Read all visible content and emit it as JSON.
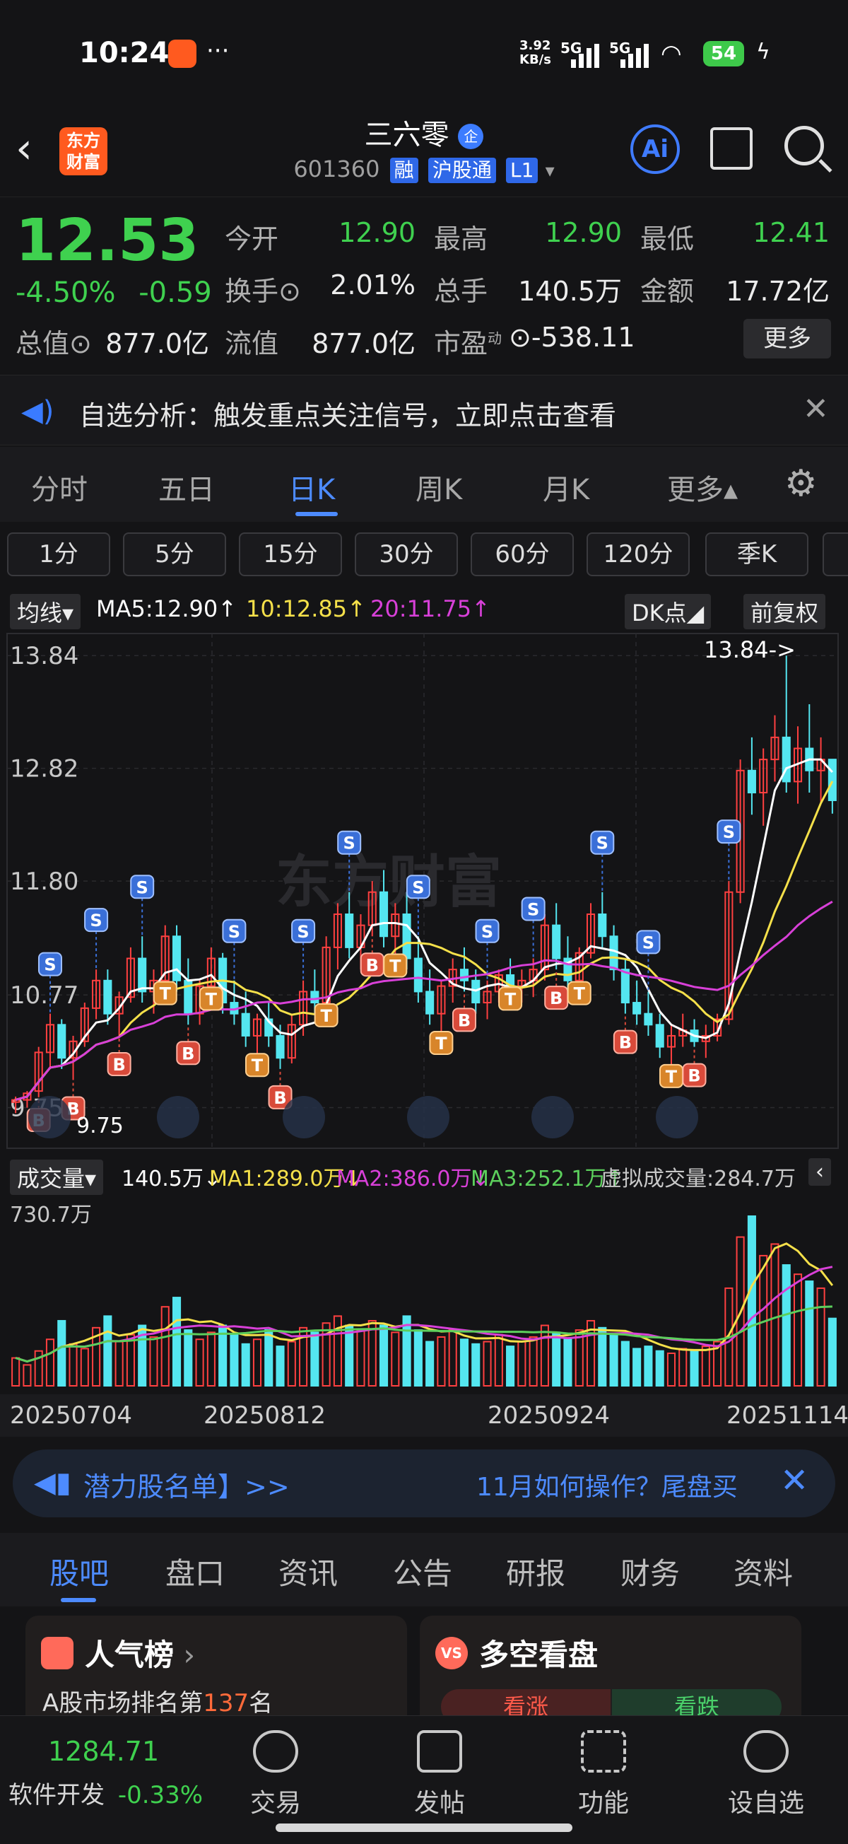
{
  "status_bar": {
    "time": "10:24",
    "net_speed_value": "3.92",
    "net_speed_unit": "KB/s",
    "sig1": "5G",
    "sig2": "5G",
    "battery": "54"
  },
  "header": {
    "logo_line1": "东方",
    "logo_line2": "财富",
    "stock_name": "三六零",
    "badge": "企",
    "stock_code": "601360",
    "tags": [
      "融",
      "沪股通",
      "L1"
    ],
    "ai_label": "Ai"
  },
  "quote": {
    "price": "12.53",
    "change_pct": "-4.50%",
    "change_amt": "-0.59",
    "rows": [
      [
        {
          "label": "今开",
          "value": "12.90",
          "green": true
        },
        {
          "label": "最高",
          "value": "12.90",
          "green": true
        },
        {
          "label": "最低",
          "value": "12.41",
          "green": true
        }
      ],
      [
        {
          "label": "换手⊙",
          "value": "2.01%",
          "green": false
        },
        {
          "label": "总手",
          "value": "140.5万",
          "green": false
        },
        {
          "label": "金额",
          "value": "17.72亿",
          "green": false
        }
      ]
    ],
    "total_value_label": "总值⊙",
    "total_value": "877.0亿",
    "float_label": "流值",
    "float_value": "877.0亿",
    "pe_label": "市盈",
    "pe_sup": "动",
    "pe_value": "⊙-538.11",
    "more": "更多"
  },
  "notice": {
    "text": "自选分析：触发重点关注信号，立即点击查看"
  },
  "tabs": [
    {
      "label": "分时",
      "active": false
    },
    {
      "label": "五日",
      "active": false
    },
    {
      "label": "日K",
      "active": true
    },
    {
      "label": "周K",
      "active": false
    },
    {
      "label": "月K",
      "active": false
    },
    {
      "label": "更多▴",
      "active": false
    }
  ],
  "periods": [
    "1分",
    "5分",
    "15分",
    "30分",
    "60分",
    "120分",
    "季K"
  ],
  "ma_row": {
    "selector": "均线▾",
    "ma5": "MA5:12.90↑",
    "ma10": "10:12.85↑",
    "ma20": "20:11.75↑",
    "dk": "DK点◢",
    "adjust": "前复权"
  },
  "colors": {
    "up": "#ff4040",
    "down": "#54e6f0",
    "ma5": "#ffffff",
    "ma10": "#f5e04a",
    "ma20": "#d840d8",
    "ma3": "#5ccf5c",
    "accent": "#4d8bff"
  },
  "chart_data": {
    "type": "candlestick",
    "y_ticks": [
      "13.84",
      "12.82",
      "11.80",
      "10.77",
      "9.75"
    ],
    "ylim": [
      9.6,
      13.95
    ],
    "high_label": "13.84->",
    "low_label": "9.75",
    "watermark": "东方财富",
    "candles": [
      [
        9.8,
        9.85,
        9.7,
        9.82
      ],
      [
        9.82,
        9.9,
        9.75,
        9.88
      ],
      [
        9.9,
        10.3,
        9.85,
        10.25
      ],
      [
        10.25,
        10.6,
        10.1,
        10.5
      ],
      [
        10.5,
        10.55,
        10.1,
        10.2
      ],
      [
        10.2,
        10.4,
        10.0,
        10.35
      ],
      [
        10.35,
        10.7,
        10.3,
        10.65
      ],
      [
        10.65,
        11.0,
        10.55,
        10.9
      ],
      [
        10.9,
        11.0,
        10.5,
        10.6
      ],
      [
        10.6,
        10.8,
        10.4,
        10.75
      ],
      [
        10.75,
        11.2,
        10.7,
        11.1
      ],
      [
        11.1,
        11.3,
        10.7,
        10.8
      ],
      [
        10.8,
        11.0,
        10.6,
        10.9
      ],
      [
        10.9,
        11.4,
        10.85,
        11.3
      ],
      [
        11.3,
        11.4,
        10.8,
        10.9
      ],
      [
        10.9,
        11.1,
        10.5,
        10.6
      ],
      [
        10.6,
        10.9,
        10.5,
        10.85
      ],
      [
        10.85,
        11.2,
        10.8,
        11.1
      ],
      [
        11.1,
        11.15,
        10.6,
        10.7
      ],
      [
        10.7,
        10.9,
        10.5,
        10.6
      ],
      [
        10.6,
        10.8,
        10.3,
        10.4
      ],
      [
        10.4,
        10.6,
        10.2,
        10.55
      ],
      [
        10.55,
        10.7,
        10.3,
        10.4
      ],
      [
        10.4,
        10.5,
        10.1,
        10.2
      ],
      [
        10.2,
        10.6,
        10.15,
        10.5
      ],
      [
        10.5,
        10.9,
        10.4,
        10.8
      ],
      [
        10.8,
        11.0,
        10.6,
        10.7
      ],
      [
        10.7,
        11.3,
        10.65,
        11.2
      ],
      [
        11.2,
        11.6,
        11.0,
        11.5
      ],
      [
        11.5,
        11.7,
        11.1,
        11.2
      ],
      [
        11.2,
        11.5,
        11.0,
        11.4
      ],
      [
        11.4,
        11.8,
        11.3,
        11.7
      ],
      [
        11.7,
        11.9,
        11.2,
        11.3
      ],
      [
        11.3,
        11.6,
        11.1,
        11.5
      ],
      [
        11.5,
        11.7,
        11.0,
        11.1
      ],
      [
        11.1,
        11.3,
        10.7,
        10.8
      ],
      [
        10.8,
        11.0,
        10.5,
        10.6
      ],
      [
        10.6,
        10.9,
        10.4,
        10.85
      ],
      [
        10.85,
        11.1,
        10.7,
        11.0
      ],
      [
        11.0,
        11.2,
        10.8,
        10.9
      ],
      [
        10.9,
        11.0,
        10.6,
        10.7
      ],
      [
        10.7,
        10.9,
        10.55,
        10.8
      ],
      [
        10.8,
        11.0,
        10.7,
        10.95
      ],
      [
        10.95,
        11.1,
        10.8,
        10.85
      ],
      [
        10.85,
        11.0,
        10.7,
        10.9
      ],
      [
        10.9,
        11.1,
        10.75,
        11.0
      ],
      [
        11.0,
        11.5,
        10.9,
        11.4
      ],
      [
        11.4,
        11.6,
        11.0,
        11.1
      ],
      [
        11.1,
        11.3,
        10.8,
        10.9
      ],
      [
        10.9,
        11.2,
        10.85,
        11.15
      ],
      [
        11.15,
        11.6,
        11.1,
        11.5
      ],
      [
        11.5,
        11.7,
        11.2,
        11.3
      ],
      [
        11.3,
        11.4,
        10.9,
        11.0
      ],
      [
        11.0,
        11.1,
        10.6,
        10.7
      ],
      [
        10.7,
        10.9,
        10.5,
        10.6
      ],
      [
        10.6,
        10.8,
        10.4,
        10.5
      ],
      [
        10.5,
        10.6,
        10.2,
        10.3
      ],
      [
        10.3,
        10.5,
        10.1,
        10.4
      ],
      [
        10.4,
        10.6,
        10.3,
        10.45
      ],
      [
        10.45,
        10.55,
        10.3,
        10.35
      ],
      [
        10.35,
        10.5,
        10.2,
        10.4
      ],
      [
        10.4,
        10.6,
        10.35,
        10.55
      ],
      [
        10.55,
        11.8,
        10.5,
        11.7
      ],
      [
        11.7,
        12.9,
        11.6,
        12.8
      ],
      [
        12.8,
        13.1,
        12.4,
        12.6
      ],
      [
        12.6,
        13.0,
        12.3,
        12.9
      ],
      [
        12.9,
        13.3,
        12.7,
        13.1
      ],
      [
        13.1,
        13.84,
        12.6,
        12.7
      ],
      [
        12.7,
        13.2,
        12.5,
        13.0
      ],
      [
        13.0,
        13.4,
        12.6,
        12.8
      ],
      [
        12.8,
        13.1,
        12.5,
        12.9
      ],
      [
        12.9,
        12.9,
        12.41,
        12.53
      ]
    ],
    "signals": [
      {
        "i": 2,
        "t": "B"
      },
      {
        "i": 3,
        "t": "S"
      },
      {
        "i": 5,
        "t": "B"
      },
      {
        "i": 7,
        "t": "S"
      },
      {
        "i": 9,
        "t": "B"
      },
      {
        "i": 11,
        "t": "S"
      },
      {
        "i": 13,
        "t": "T"
      },
      {
        "i": 15,
        "t": "B"
      },
      {
        "i": 17,
        "t": "T"
      },
      {
        "i": 19,
        "t": "S"
      },
      {
        "i": 21,
        "t": "T"
      },
      {
        "i": 23,
        "t": "B"
      },
      {
        "i": 25,
        "t": "S"
      },
      {
        "i": 27,
        "t": "T"
      },
      {
        "i": 29,
        "t": "S"
      },
      {
        "i": 31,
        "t": "B"
      },
      {
        "i": 33,
        "t": "T"
      },
      {
        "i": 35,
        "t": "S"
      },
      {
        "i": 37,
        "t": "T"
      },
      {
        "i": 39,
        "t": "B"
      },
      {
        "i": 41,
        "t": "S"
      },
      {
        "i": 43,
        "t": "T"
      },
      {
        "i": 45,
        "t": "S"
      },
      {
        "i": 47,
        "t": "B"
      },
      {
        "i": 49,
        "t": "T"
      },
      {
        "i": 51,
        "t": "S"
      },
      {
        "i": 53,
        "t": "B"
      },
      {
        "i": 55,
        "t": "S"
      },
      {
        "i": 57,
        "t": "T"
      },
      {
        "i": 59,
        "t": "B"
      },
      {
        "i": 62,
        "t": "S"
      }
    ],
    "volumes": [
      120,
      90,
      150,
      200,
      280,
      180,
      160,
      250,
      300,
      190,
      220,
      260,
      210,
      340,
      380,
      240,
      200,
      230,
      260,
      220,
      180,
      200,
      240,
      170,
      190,
      250,
      230,
      270,
      300,
      260,
      240,
      280,
      260,
      230,
      300,
      240,
      190,
      210,
      240,
      200,
      180,
      190,
      220,
      170,
      190,
      210,
      260,
      230,
      200,
      240,
      280,
      250,
      220,
      190,
      160,
      170,
      150,
      140,
      160,
      150,
      170,
      190,
      420,
      640,
      730,
      560,
      610,
      520,
      480,
      450,
      420,
      290
    ],
    "vol_max_label": "730.7万",
    "date_labels": [
      "20250704",
      "20250812",
      "20250924",
      "20251114"
    ]
  },
  "vol_row": {
    "selector": "成交量▾",
    "vol": "140.5万↓",
    "ma1": "MA1:289.0万↓",
    "ma2": "MA2:386.0万↓",
    "ma3": "MA3:252.1万↑",
    "virtual": "虚拟成交量:284.7万"
  },
  "ad": {
    "left_text": "潜力股名单】>>",
    "right_text": "11月如何操作？尾盘买"
  },
  "bottom_tabs": [
    {
      "label": "股吧",
      "active": true
    },
    {
      "label": "盘口",
      "active": false
    },
    {
      "label": "资讯",
      "active": false
    },
    {
      "label": "公告",
      "active": false
    },
    {
      "label": "研报",
      "active": false
    },
    {
      "label": "财务",
      "active": false
    },
    {
      "label": "资料",
      "active": false
    }
  ],
  "cards": {
    "left_title": "人气榜",
    "left_sub_prefix": "A股市场排名第",
    "left_rank": "137",
    "left_sub_suffix": "名",
    "right_title": "多空看盘",
    "right_up": "看涨",
    "right_down": "看跌"
  },
  "bottom_nav": {
    "index_value": "1284.71",
    "index_name": "软件开发",
    "index_change": "-0.33%",
    "items": [
      "交易",
      "发帖",
      "功能",
      "设自选"
    ]
  }
}
